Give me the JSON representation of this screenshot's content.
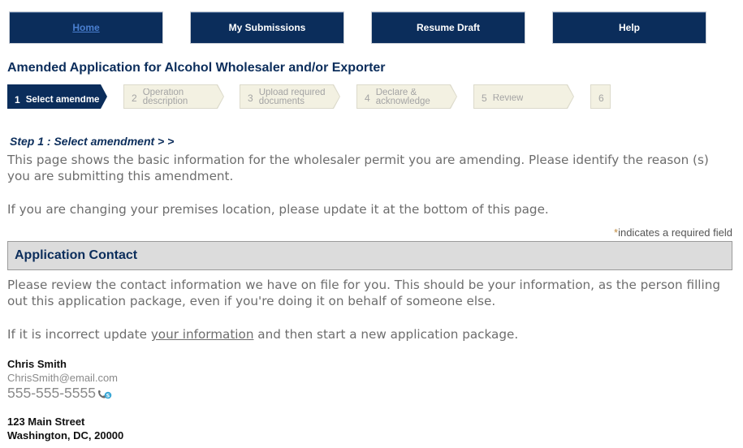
{
  "nav": {
    "home": "Home",
    "my_submissions": "My Submissions",
    "resume_draft": "Resume Draft",
    "help": "Help"
  },
  "page_title": "Amended Application for Alcohol Wholesaler and/or Exporter",
  "stepper": {
    "steps": [
      {
        "num": "1",
        "label": "Select amendme",
        "state": "active"
      },
      {
        "num": "2",
        "label": "Operation description",
        "state": "inactive"
      },
      {
        "num": "3",
        "label": "Upload required documents",
        "state": "inactive"
      },
      {
        "num": "4",
        "label": "Declare & acknowledge",
        "state": "inactive"
      },
      {
        "num": "5",
        "label": "Review",
        "state": "inactive"
      },
      {
        "num": "6",
        "label": "",
        "state": "inactive"
      }
    ]
  },
  "step_heading": "Step 1 : Select amendment > >",
  "intro": {
    "para1": "This page shows the basic information for the wholesaler permit you are amending. Please identify the reason (s) you are submitting this amendment.",
    "para2": "If you are changing your premises location, please update it at the bottom of this page."
  },
  "required_note": {
    "star": "*",
    "text": "indicates a required field"
  },
  "section": {
    "title": "Application Contact",
    "para1": "Please review the contact information we have on file for you.  This should be your information, as the person filling out this application package, even if you're doing it on behalf of someone else.",
    "para2_before": "If it is incorrect update ",
    "para2_link": "your information",
    "para2_after": " and then start a new application package."
  },
  "contact": {
    "name": "Chris  Smith",
    "email": "ChrisSmith@email.com",
    "phone": "555-555-5555",
    "address_line1": "123 Main Street",
    "address_line2": "Washington, DC, 20000"
  },
  "colors": {
    "nav_bg": "#0b2d5b",
    "title_blue": "#0b2d5b",
    "step_inactive_bg": "#f3f1e2",
    "section_bg": "#dcdcdc",
    "required_star": "#c08a3e"
  },
  "icons": {
    "phone": "phone-icon",
    "skype": "skype-icon"
  }
}
